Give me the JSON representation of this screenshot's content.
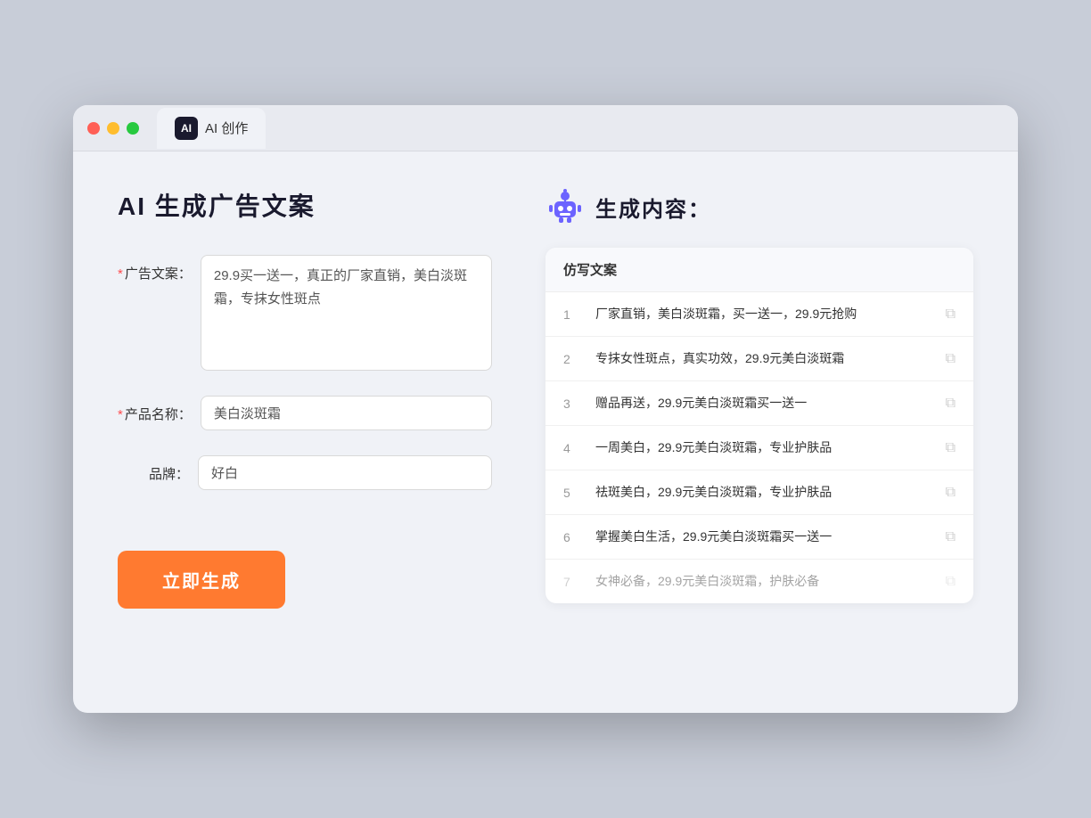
{
  "window": {
    "tab_label": "AI 创作",
    "tab_icon": "AI"
  },
  "left": {
    "title": "AI 生成广告文案",
    "ad_label": "广告文案：",
    "ad_required": "*",
    "ad_value": "29.9买一送一，真正的厂家直销，美白淡斑霜，专抹女性斑点",
    "product_label": "产品名称：",
    "product_required": "*",
    "product_value": "美白淡斑霜",
    "brand_label": "品牌：",
    "brand_value": "好白",
    "generate_btn": "立即生成"
  },
  "right": {
    "title": "生成内容：",
    "table_header": "仿写文案",
    "rows": [
      {
        "num": 1,
        "text": "厂家直销，美白淡斑霜，买一送一，29.9元抢购",
        "dimmed": false
      },
      {
        "num": 2,
        "text": "专抹女性斑点，真实功效，29.9元美白淡斑霜",
        "dimmed": false
      },
      {
        "num": 3,
        "text": "赠品再送，29.9元美白淡斑霜买一送一",
        "dimmed": false
      },
      {
        "num": 4,
        "text": "一周美白，29.9元美白淡斑霜，专业护肤品",
        "dimmed": false
      },
      {
        "num": 5,
        "text": "祛斑美白，29.9元美白淡斑霜，专业护肤品",
        "dimmed": false
      },
      {
        "num": 6,
        "text": "掌握美白生活，29.9元美白淡斑霜买一送一",
        "dimmed": false
      },
      {
        "num": 7,
        "text": "女神必备，29.9元美白淡斑霜，护肤必备",
        "dimmed": true
      }
    ]
  }
}
